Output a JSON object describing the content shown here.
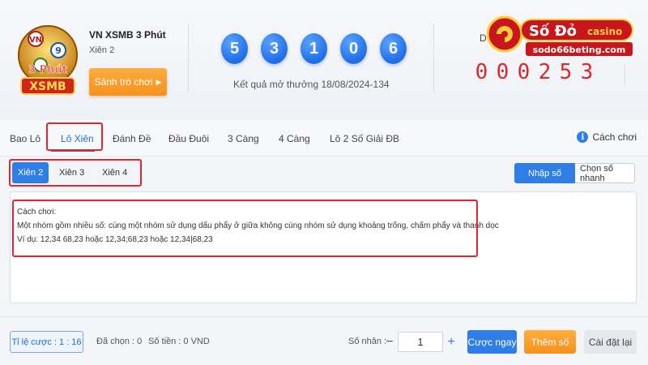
{
  "header": {
    "game_name": "VN XSMB 3 Phút",
    "game_sub": "Xiên 2",
    "lobby_button": "Sảnh trò chơi",
    "balls": [
      "5",
      "3",
      "1",
      "0",
      "6"
    ],
    "result_line": "Kết quả mở thưởng 18/08/2024-134",
    "countdown_label": "D",
    "countdown": [
      "0",
      "0",
      "0",
      "2",
      "5",
      "3"
    ],
    "logo": {
      "top": "3 Phút",
      "bottom": "XSMB"
    },
    "brand": {
      "name": "Số Đỏ",
      "suffix": "casino",
      "url": "sodo66beting.com"
    }
  },
  "tabs": [
    {
      "label": "Bao Lô"
    },
    {
      "label": "Lô Xiên",
      "active": true
    },
    {
      "label": "Đánh Đề"
    },
    {
      "label": "Đầu Đuôi"
    },
    {
      "label": "3 Càng"
    },
    {
      "label": "4 Càng"
    },
    {
      "label": "Lô 2 Số Giải ĐB"
    }
  ],
  "howto_label": "Cách chơi",
  "subtabs": [
    {
      "label": "Xiên 2",
      "active": true
    },
    {
      "label": "Xiên 3"
    },
    {
      "label": "Xiên 4"
    }
  ],
  "modes": {
    "enter": "Nhập số",
    "quick": "Chọn số nhanh"
  },
  "guide": {
    "title": "Cách chơi:",
    "line1": "Một nhóm gồm nhiều số: cùng một nhóm sử dụng dấu phẩy ở giữa không cùng nhóm sử dụng khoảng trống, chấm phẩy và thanh dọc",
    "line2": "Ví dụ: 12,34 68,23 hoặc 12,34;68,23 hoặc 12,34|68,23"
  },
  "footer": {
    "odds_label": "Tỉ lệ cược : 1 : 16",
    "selected_label": "Đã chọn : 0",
    "amount_label": "Số tiền : 0 VND",
    "multiplier_label": "Số nhân :",
    "multiplier_value": "1",
    "minus": "−",
    "plus": "+",
    "bet_now": "Cược ngay",
    "add_number": "Thêm số",
    "reset": "Cài đặt lại"
  },
  "colors": {
    "accent": "#2f7ee8",
    "orange": "#f7901e",
    "highlight": "#e8232b",
    "countdown": "#e0262a"
  }
}
